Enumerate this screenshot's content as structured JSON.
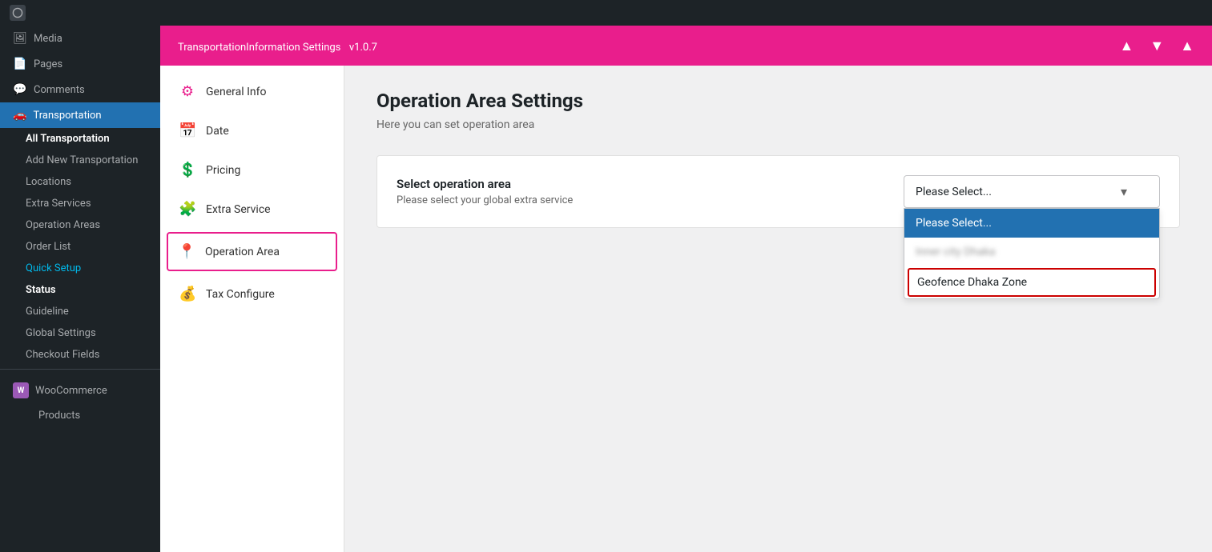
{
  "topbar": {
    "items": []
  },
  "sidebar": {
    "media_label": "Media",
    "pages_label": "Pages",
    "comments_label": "Comments",
    "transportation_label": "Transportation",
    "all_transportation_label": "All Transportation",
    "add_new_label": "Add New Transportation",
    "locations_label": "Locations",
    "extra_services_label": "Extra Services",
    "operation_areas_label": "Operation Areas",
    "order_list_label": "Order List",
    "quick_setup_label": "Quick Setup",
    "status_label": "Status",
    "guideline_label": "Guideline",
    "global_settings_label": "Global Settings",
    "checkout_fields_label": "Checkout Fields",
    "woocommerce_label": "WooCommerce",
    "products_label": "Products"
  },
  "plugin_header": {
    "title": "TransportationInformation Settings",
    "version": "v1.0.7",
    "btn_up": "▲",
    "btn_down": "▼",
    "btn_close": "▲"
  },
  "settings_nav": {
    "items": [
      {
        "id": "general-info",
        "label": "General Info",
        "icon": "⚙"
      },
      {
        "id": "date",
        "label": "Date",
        "icon": "📅"
      },
      {
        "id": "pricing",
        "label": "Pricing",
        "icon": "💲"
      },
      {
        "id": "extra-service",
        "label": "Extra Service",
        "icon": "🧩"
      },
      {
        "id": "operation-area",
        "label": "Operation Area",
        "icon": "📍",
        "active": true
      },
      {
        "id": "tax-configure",
        "label": "Tax Configure",
        "icon": "💰"
      }
    ]
  },
  "page": {
    "title": "Operation Area Settings",
    "subtitle": "Here you can set operation area",
    "card": {
      "label": "Select operation area",
      "sublabel": "Please select your global extra service",
      "dropdown": {
        "placeholder": "Please Select...",
        "selected_text": "Please Select...",
        "options": [
          {
            "id": "please-select",
            "label": "Please Select...",
            "selected": true
          },
          {
            "id": "innerdhaka",
            "label": "Inner city Dhaka",
            "blurred": true
          },
          {
            "id": "geofence-dhaka",
            "label": "Geofence Dhaka Zone",
            "highlighted": true
          }
        ]
      }
    }
  }
}
